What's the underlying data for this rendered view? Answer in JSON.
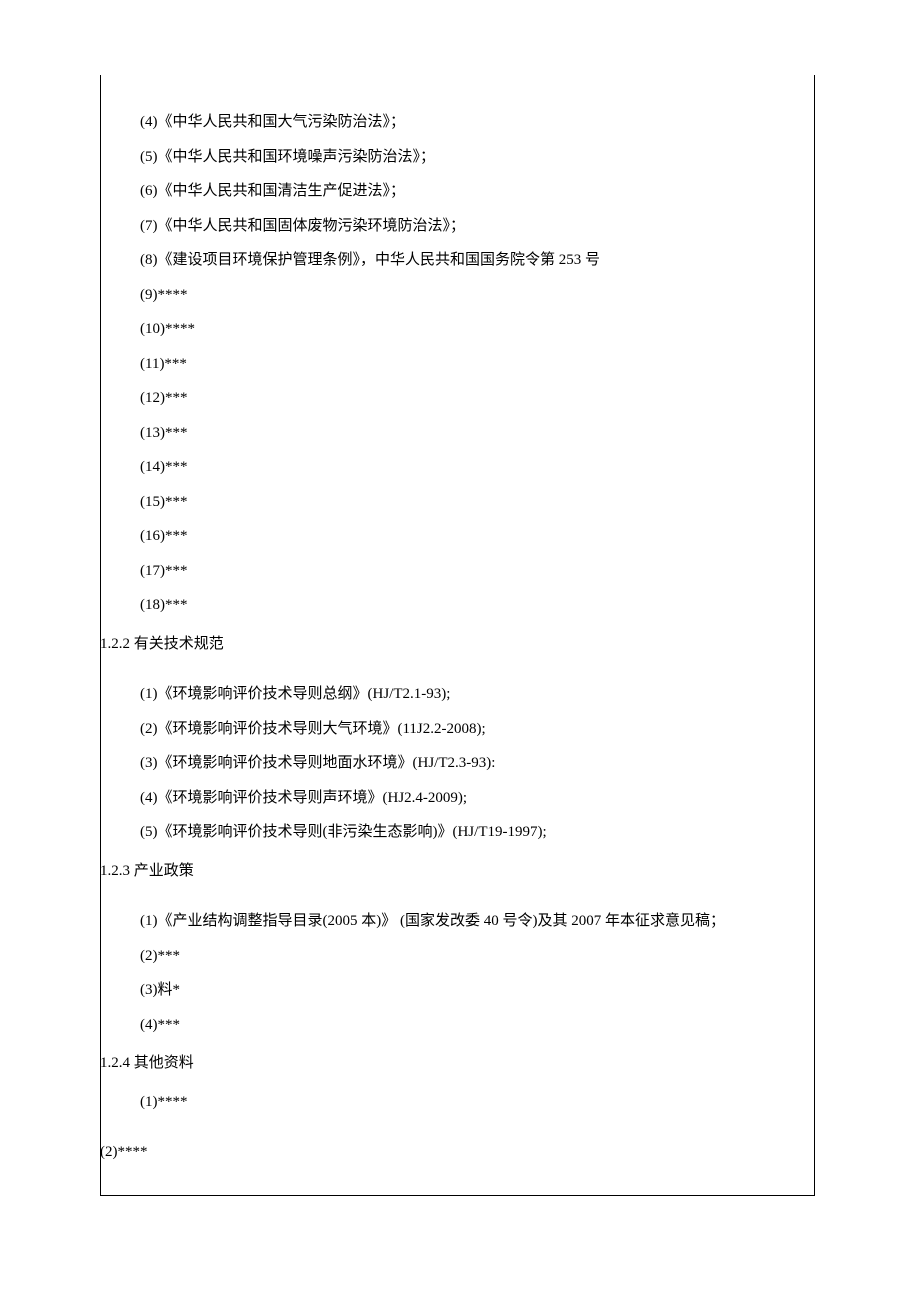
{
  "section_1_items": [
    "(4)《中华人民共和国大气污染防治法》；",
    "(5)《中华人民共和国环境噪声污染防治法》；",
    "(6)《中华人民共和国清洁生产促进法》；",
    "(7)《中华人民共和国固体废物污染环境防治法》；",
    "(8)《建设项目环境保护管理条例》，中华人民共和国国务院令第 253 号",
    "(9)****",
    "(10)****",
    "(11)***",
    "(12)***",
    "(13)***",
    "(14)***",
    "(15)***",
    "(16)***",
    "(17)***",
    "(18)***"
  ],
  "heading_122": "1.2.2 有关技术规范",
  "section_2_items": [
    "(1)《环境影响评价技术导则总纲》(HJ/T2.1-93);",
    "(2)《环境影响评价技术导则大气环境》(11J2.2-2008);",
    "(3)《环境影响评价技术导则地面水环境》(HJ/T2.3-93):",
    "(4)《环境影响评价技术导则声环境》(HJ2.4-2009);",
    "(5)《环境影响评价技术导则(非污染生态影响)》(HJ/T19-1997);"
  ],
  "heading_123": "1.2.3 产业政策",
  "section_3_items": [
    "(1)《产业结构调整指导目录(2005 本)》 (国家发改委 40 号令)及其 2007 年本征求意见稿；",
    "(2)***",
    "(3)料*",
    "(4)***"
  ],
  "heading_124": "1.2.4 其他资料",
  "section_4_items": [
    "(1)****"
  ],
  "section_4_outdent": "(2)****"
}
